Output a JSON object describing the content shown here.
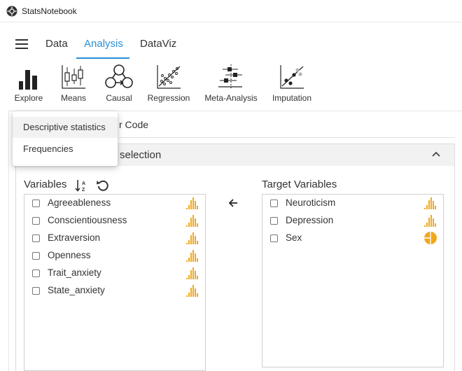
{
  "window": {
    "title": "StatsNotebook"
  },
  "menu": {
    "tabs": [
      {
        "label": "Data"
      },
      {
        "label": "Analysis"
      },
      {
        "label": "DataViz"
      }
    ],
    "active_tab": "Analysis"
  },
  "ribbon": {
    "buttons": [
      {
        "label": "Explore",
        "icon": "bar-chart-icon"
      },
      {
        "label": "Means",
        "icon": "candlestick-icon"
      },
      {
        "label": "Causal",
        "icon": "causal-graph-icon"
      },
      {
        "label": "Regression",
        "icon": "scatter-regression-icon"
      },
      {
        "label": "Meta-Analysis",
        "icon": "forest-plot-icon"
      },
      {
        "label": "Imputation",
        "icon": "imputation-icon"
      }
    ]
  },
  "dropdown": {
    "items": [
      {
        "label": "Descriptive statistics"
      },
      {
        "label": "Frequencies"
      }
    ]
  },
  "code_tab": {
    "label": "r Code"
  },
  "panel": {
    "title": "selection"
  },
  "variables": {
    "label": "Variables",
    "items": [
      {
        "name": "Agreeableness",
        "type": "numeric"
      },
      {
        "name": "Conscientiousness",
        "type": "numeric"
      },
      {
        "name": "Extraversion",
        "type": "numeric"
      },
      {
        "name": "Openness",
        "type": "numeric"
      },
      {
        "name": "Trait_anxiety",
        "type": "numeric"
      },
      {
        "name": "State_anxiety",
        "type": "numeric"
      }
    ]
  },
  "target": {
    "label": "Target Variables",
    "items": [
      {
        "name": "Neuroticism",
        "type": "numeric"
      },
      {
        "name": "Depression",
        "type": "numeric"
      },
      {
        "name": "Sex",
        "type": "factor"
      }
    ]
  },
  "colors": {
    "accent": "#2a8fd6",
    "type_icon": "#f2a81d"
  }
}
